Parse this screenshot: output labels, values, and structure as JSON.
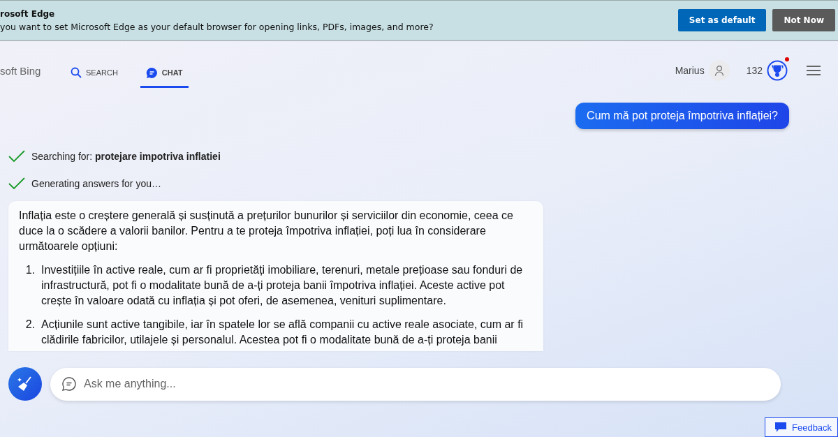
{
  "banner": {
    "title": "rosoft Edge",
    "message": "you want to set Microsoft Edge as your default browser for opening links, PDFs, images, and more?",
    "buttons": [
      {
        "label": "Set as default",
        "kind": "primary"
      },
      {
        "label": "Not Now",
        "kind": "secondary"
      }
    ]
  },
  "header": {
    "brand": "soft Bing",
    "tabs": [
      {
        "label": "SEARCH",
        "selected": false
      },
      {
        "label": "CHAT",
        "selected": true
      }
    ],
    "user": "Marius",
    "points": "132",
    "notification": true
  },
  "chat": {
    "user_message": "Cum mă pot proteja împotriva inflației?",
    "steps": [
      {
        "text": "Searching for: **protejare impotriva inflatiei**",
        "done": true
      },
      {
        "text": "Generating answers for you…",
        "done": true
      }
    ],
    "answer": {
      "intro": "Inflația este o creștere generală și susținută a prețurilor bunurilor și serviciilor din economie, ceea ce duce la o scădere a valorii banilor. Pentru a te proteja împotriva inflației, poți lua în considerare următoarele opțiuni:",
      "items": [
        {
          "number": "1.",
          "text": "Investițiile în active reale, cum ar fi proprietăți imobiliare, terenuri, metale prețioase sau fonduri de infrastructură, pot fi o modalitate bună de a-ți proteja banii împotriva inflației. Aceste active pot crește în valoare odată cu inflația și pot oferi, de asemenea, venituri suplimentare."
        },
        {
          "number": "2.",
          "text": "Acțiunile sunt active tangibile, iar în spatele lor se află companii cu active reale asociate, cum ar fi clădirile fabricilor, utilajele și personalul. Acestea pot fi o modalitate bună de a-ți proteja banii"
        }
      ]
    }
  },
  "input": {
    "placeholder": "Ask me anything..."
  },
  "feedback": "Feedback"
}
